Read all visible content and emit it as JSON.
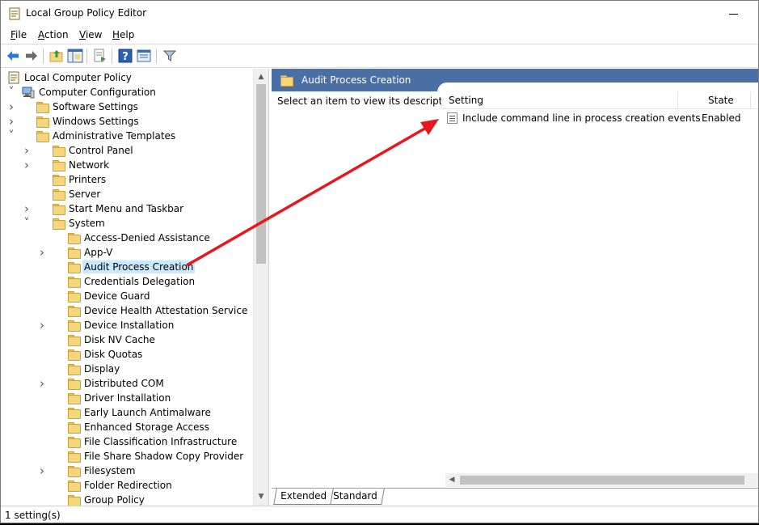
{
  "window": {
    "title": "Local Group Policy Editor"
  },
  "menu": [
    {
      "label": "File",
      "u": "F",
      "rest": "ile"
    },
    {
      "label": "Action",
      "u": "A",
      "rest": "ction"
    },
    {
      "label": "View",
      "u": "V",
      "rest": "iew"
    },
    {
      "label": "Help",
      "u": "H",
      "rest": "elp"
    }
  ],
  "toolbar": {
    "buttons": [
      "back-arrow-icon",
      "forward-arrow-icon",
      "up-folder-icon",
      "show-hide-tree-icon",
      "export-list-icon",
      "help-icon",
      "properties-icon",
      "filter-icon"
    ]
  },
  "tree": {
    "items": [
      {
        "label": "Local Computer Policy",
        "icon": "policy-icon",
        "chevron": ""
      },
      {
        "label": "Computer Configuration",
        "icon": "computer-icon",
        "chevron": "v"
      },
      {
        "label": "Software Settings",
        "icon": "folder-icon",
        "chevron": ">"
      },
      {
        "label": "Windows Settings",
        "icon": "folder-icon",
        "chevron": ">"
      },
      {
        "label": "Administrative Templates",
        "icon": "folder-icon",
        "chevron": "v"
      },
      {
        "label": "Control Panel",
        "icon": "folder-icon",
        "chevron": ">"
      },
      {
        "label": "Network",
        "icon": "folder-icon",
        "chevron": ">"
      },
      {
        "label": "Printers",
        "icon": "folder-icon",
        "chevron": ""
      },
      {
        "label": "Server",
        "icon": "folder-icon",
        "chevron": ""
      },
      {
        "label": "Start Menu and Taskbar",
        "icon": "folder-icon",
        "chevron": ">"
      },
      {
        "label": "System",
        "icon": "folder-icon",
        "chevron": "v"
      },
      {
        "label": "Access-Denied Assistance",
        "icon": "folder-icon",
        "chevron": ""
      },
      {
        "label": "App-V",
        "icon": "folder-icon",
        "chevron": ">"
      },
      {
        "label": "Audit Process Creation",
        "icon": "folder-icon",
        "chevron": "",
        "selected": true
      },
      {
        "label": "Credentials Delegation",
        "icon": "folder-icon",
        "chevron": ""
      },
      {
        "label": "Device Guard",
        "icon": "folder-icon",
        "chevron": ""
      },
      {
        "label": "Device Health Attestation Service",
        "icon": "folder-icon",
        "chevron": ""
      },
      {
        "label": "Device Installation",
        "icon": "folder-icon",
        "chevron": ">"
      },
      {
        "label": "Disk NV Cache",
        "icon": "folder-icon",
        "chevron": ""
      },
      {
        "label": "Disk Quotas",
        "icon": "folder-icon",
        "chevron": ""
      },
      {
        "label": "Display",
        "icon": "folder-icon",
        "chevron": ""
      },
      {
        "label": "Distributed COM",
        "icon": "folder-icon",
        "chevron": ">"
      },
      {
        "label": "Driver Installation",
        "icon": "folder-icon",
        "chevron": ""
      },
      {
        "label": "Early Launch Antimalware",
        "icon": "folder-icon",
        "chevron": ""
      },
      {
        "label": "Enhanced Storage Access",
        "icon": "folder-icon",
        "chevron": ""
      },
      {
        "label": "File Classification Infrastructure",
        "icon": "folder-icon",
        "chevron": ""
      },
      {
        "label": "File Share Shadow Copy Provider",
        "icon": "folder-icon",
        "chevron": ""
      },
      {
        "label": "Filesystem",
        "icon": "folder-icon",
        "chevron": ">"
      },
      {
        "label": "Folder Redirection",
        "icon": "folder-icon",
        "chevron": ""
      },
      {
        "label": "Group Policy",
        "icon": "folder-icon",
        "chevron": ""
      }
    ]
  },
  "right_pane": {
    "header": "Audit Process Creation",
    "description": "Select an item to view its description.",
    "columns": {
      "setting": "Setting",
      "state": "State"
    },
    "rows": [
      {
        "setting": "Include command line in process creation events",
        "state": "Enabled"
      }
    ],
    "tabs": {
      "extended": "Extended",
      "standard": "Standard"
    }
  },
  "status": {
    "text": "1 setting(s)"
  },
  "annotation": {
    "arrow_color": "#e8171d"
  }
}
